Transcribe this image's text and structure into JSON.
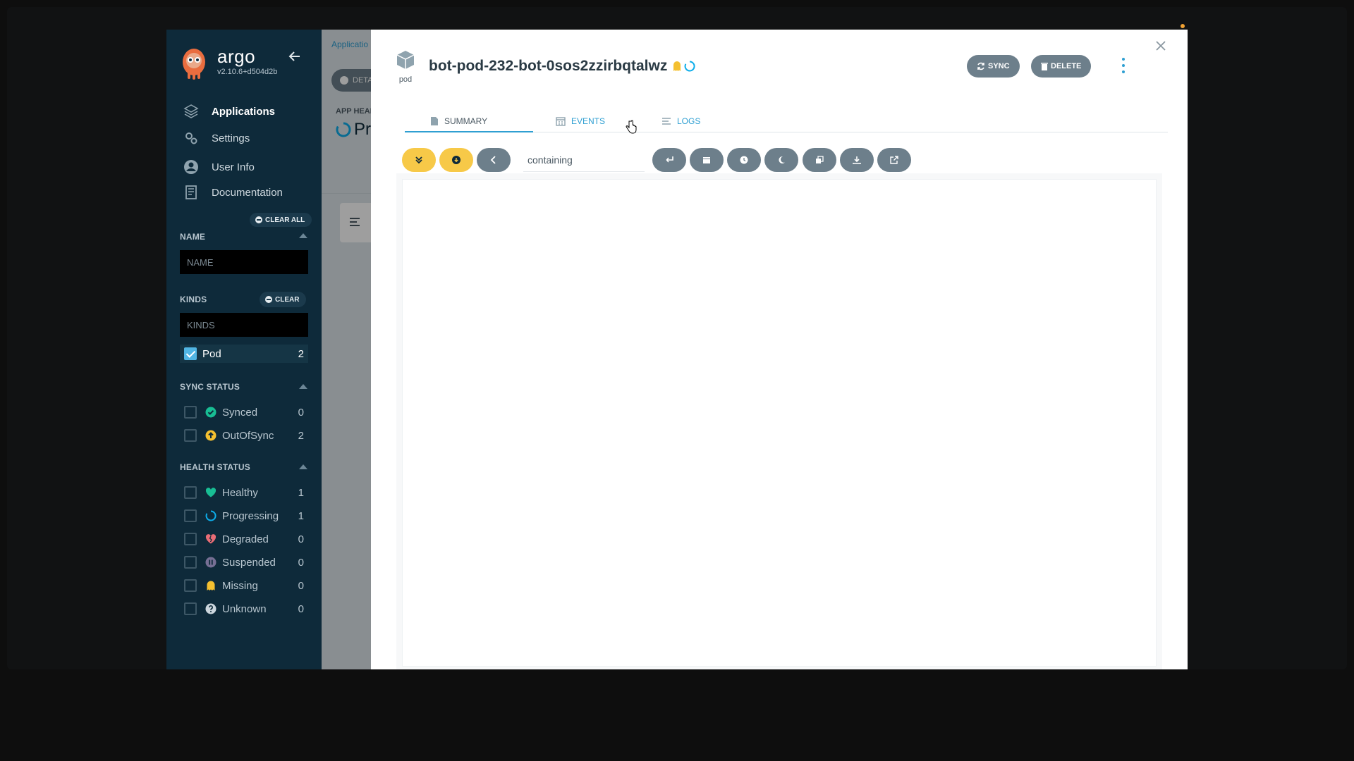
{
  "brand": {
    "name": "argo",
    "version": "v2.10.6+d504d2b"
  },
  "nav": [
    {
      "label": "Applications",
      "icon": "stack-icon",
      "active": true
    },
    {
      "label": "Settings",
      "icon": "gears-icon",
      "active": false
    },
    {
      "label": "User Info",
      "icon": "user-circle-icon",
      "active": false
    },
    {
      "label": "Documentation",
      "icon": "book-icon",
      "active": false
    }
  ],
  "filters": {
    "clear_all_label": "CLEAR ALL",
    "name": {
      "title": "NAME",
      "placeholder": "NAME"
    },
    "kinds": {
      "title": "KINDS",
      "clear_label": "CLEAR",
      "placeholder": "KINDS",
      "items": [
        {
          "label": "Pod",
          "count": "2",
          "checked": true
        }
      ]
    },
    "sync_status": {
      "title": "SYNC STATUS",
      "items": [
        {
          "label": "Synced",
          "count": "0",
          "icon": "check-circle-icon",
          "color": "#18be94"
        },
        {
          "label": "OutOfSync",
          "count": "2",
          "icon": "arrow-up-circle-icon",
          "color": "#f4c030"
        }
      ]
    },
    "health_status": {
      "title": "HEALTH STATUS",
      "items": [
        {
          "label": "Healthy",
          "count": "1",
          "icon": "heart-icon",
          "color": "#18be94"
        },
        {
          "label": "Progressing",
          "count": "1",
          "icon": "circle-notch-icon",
          "color": "#0dadea"
        },
        {
          "label": "Degraded",
          "count": "0",
          "icon": "heart-broken-icon",
          "color": "#e96d76"
        },
        {
          "label": "Suspended",
          "count": "0",
          "icon": "pause-circle-icon",
          "color": "#766f94"
        },
        {
          "label": "Missing",
          "count": "0",
          "icon": "ghost-icon",
          "color": "#f4c030"
        },
        {
          "label": "Unknown",
          "count": "0",
          "icon": "question-circle-icon",
          "color": "#ccd6dd"
        }
      ]
    }
  },
  "background": {
    "breadcrumb": "Applicatio",
    "details_button": "DETA",
    "app_health_label": "APP HEAL",
    "app_health_value": "Pr"
  },
  "panel": {
    "resource_kind": "pod",
    "resource_name": "bot-pod-232-bot-0sos2zzirbqtalwz",
    "sync_button": "SYNC",
    "delete_button": "DELETE",
    "tabs": [
      {
        "label": "SUMMARY",
        "icon": "file-icon",
        "active": true
      },
      {
        "label": "EVENTS",
        "icon": "calendar-icon",
        "active": false
      },
      {
        "label": "LOGS",
        "icon": "lines-icon",
        "active": false
      }
    ],
    "log_filter": {
      "value": "containing"
    }
  },
  "colors": {
    "sidebar": "#0e2a3a",
    "accent": "#2f9fd2",
    "toolbar_yellow": "#f7c948",
    "button_gray": "#6d7f8b"
  }
}
